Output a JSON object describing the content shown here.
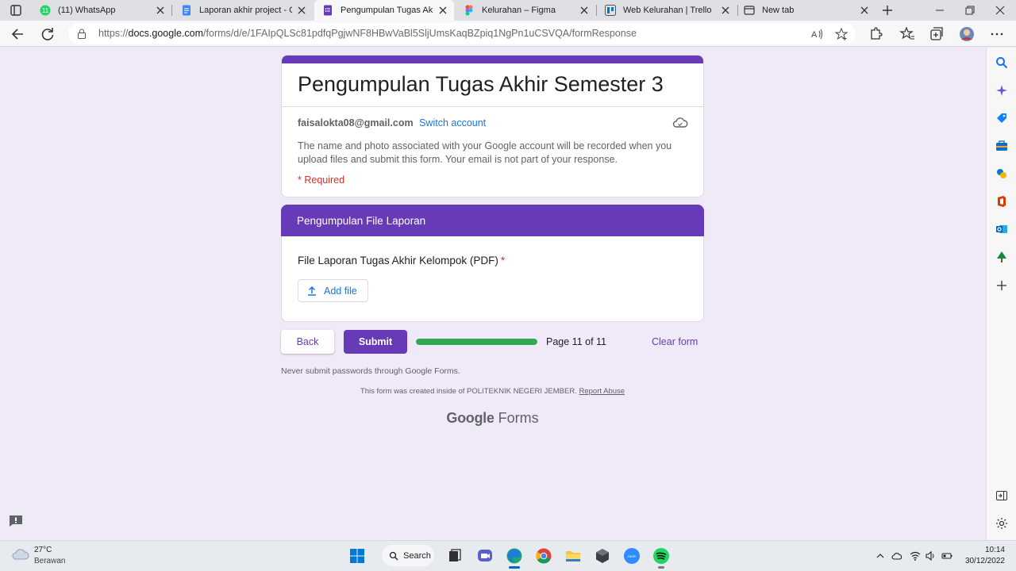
{
  "browser": {
    "tabs": [
      {
        "title": "(11) WhatsApp",
        "icon": "whatsapp-icon",
        "color": "#25d366",
        "badge": "11",
        "active": false
      },
      {
        "title": "Laporan akhir project - Goo",
        "icon": "google-docs-icon",
        "color": "#4285f4",
        "active": false
      },
      {
        "title": "Pengumpulan Tugas Akhir S",
        "icon": "google-forms-icon",
        "color": "#673ab7",
        "active": true
      },
      {
        "title": "Kelurahan – Figma",
        "icon": "figma-icon",
        "color": "#f24e1e",
        "active": false
      },
      {
        "title": "Web Kelurahan | Trello",
        "icon": "trello-icon",
        "color": "#0079bf",
        "active": false
      },
      {
        "title": "New tab",
        "icon": "new-tab-icon",
        "color": "#333333",
        "active": false
      }
    ],
    "url_prefix": "https://",
    "url_host": "docs.google.com",
    "url_path": "/forms/d/e/1FAIpQLSc81pdfqPgjwNF8HBwVaBl5SljUmsKaqBZpiq1NgPn1uCSVQA/formResponse"
  },
  "form": {
    "accent_color": "#673ab7",
    "title": "Pengumpulan Tugas Akhir Semester 3",
    "account_email": "faisalokta08@gmail.com",
    "switch_account": "Switch account",
    "notice": "The name and photo associated with your Google account will be recorded when you upload files and submit this form. Your email is not part of your response.",
    "required_note": "* Required",
    "section_title": "Pengumpulan File Laporan",
    "question_label": "File Laporan Tugas Akhir Kelompok (PDF)",
    "question_required_mark": "*",
    "add_file_label": "Add file",
    "back_label": "Back",
    "submit_label": "Submit",
    "progress_fraction": 1.0,
    "page_indicator": "Page 11 of 11",
    "clear_form_label": "Clear form",
    "never_submit": "Never submit passwords through Google Forms.",
    "created_by": "This form was created inside of POLITEKNIK NEGERI JEMBER.",
    "report_abuse": "Report Abuse",
    "brand_google": "Google",
    "brand_forms": "Forms"
  },
  "taskbar": {
    "temperature": "27°C",
    "condition": "Berawan",
    "search_label": "Search",
    "time": "10:14",
    "date": "30/12/2022"
  }
}
